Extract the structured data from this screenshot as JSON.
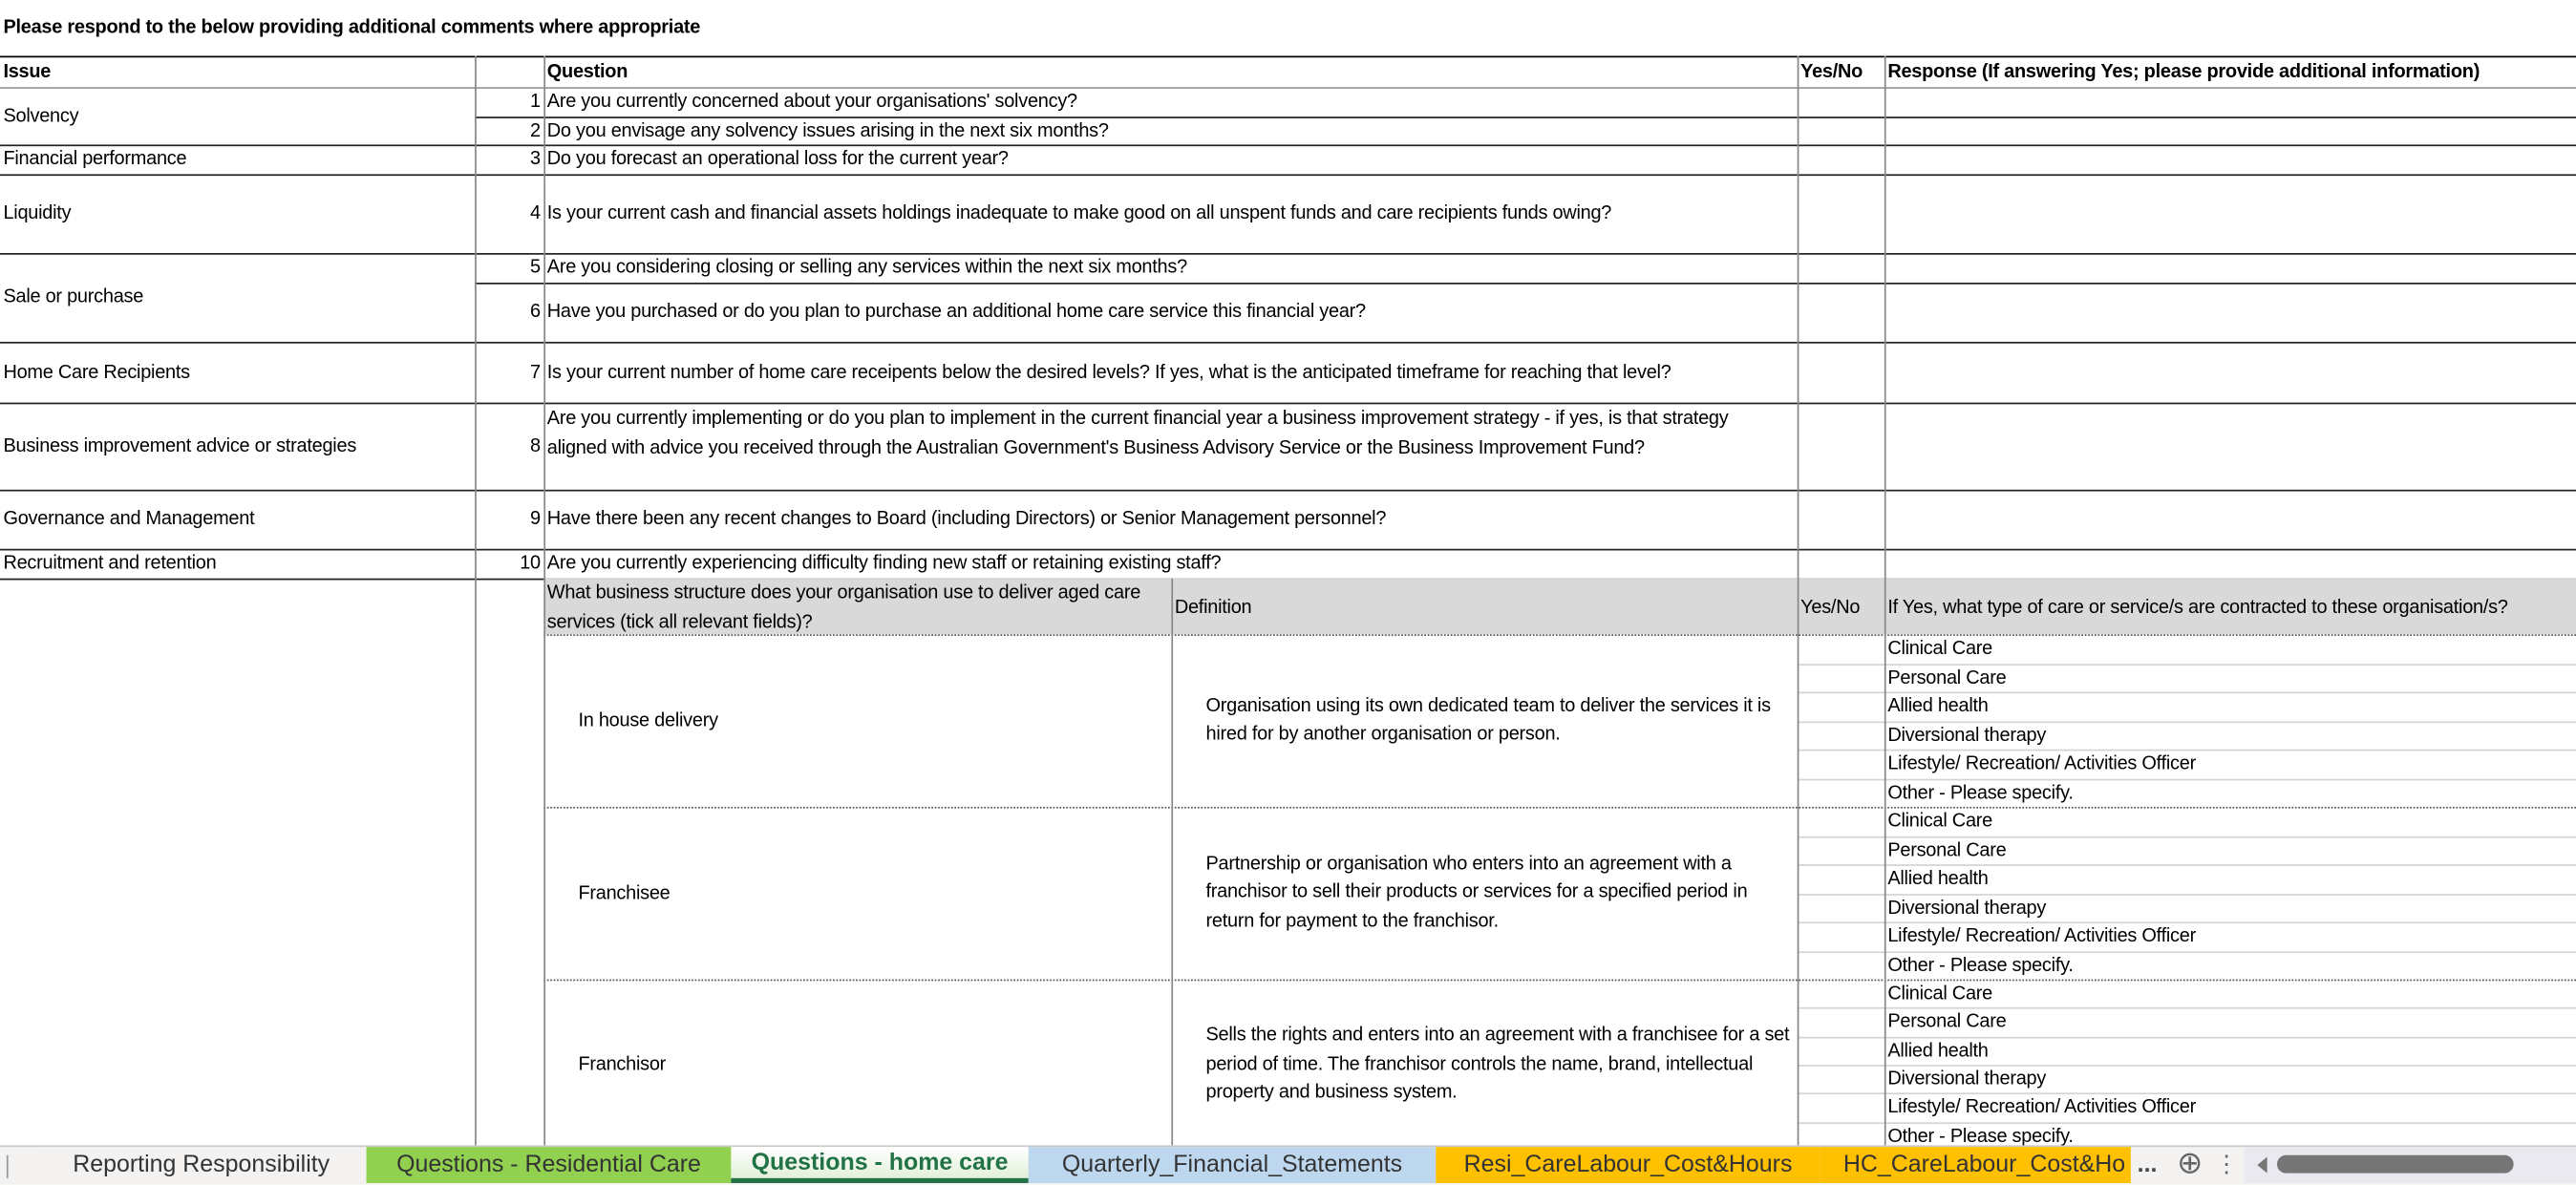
{
  "title": "Please respond to the below providing additional comments where appropriate",
  "header": {
    "issue": "Issue",
    "question": "Question",
    "yes_no": "Yes/No",
    "response": "Response (If answering Yes; please provide additional information)"
  },
  "issues": [
    {
      "label": "Solvency"
    },
    {
      "label": "Financial performance"
    },
    {
      "label": "Liquidity"
    },
    {
      "label": "Sale or purchase"
    },
    {
      "label": "Home Care Recipients"
    },
    {
      "label": "Business improvement advice or strategies"
    },
    {
      "label": "Governance and Management"
    },
    {
      "label": "Recruitment and retention"
    }
  ],
  "questions": [
    {
      "num": "1",
      "text": "Are you currently concerned about your organisations' solvency?"
    },
    {
      "num": "2",
      "text": "Do you envisage any solvency issues arising in the next six months?"
    },
    {
      "num": "3",
      "text": "Do you forecast an operational loss for the current year?"
    },
    {
      "num": "4",
      "text": "Is your current cash and financial assets holdings inadequate to make good on all unspent funds and care recipients funds owing?"
    },
    {
      "num": "5",
      "text": "Are you considering closing or selling any services within the next six months?"
    },
    {
      "num": "6",
      "text": "Have you purchased or do you plan to purchase an additional home care service this financial year?"
    },
    {
      "num": "7",
      "text": "Is your current number of home care receipents below the desired levels? If yes, what is the anticipated timeframe for reaching that level?"
    },
    {
      "num": "8",
      "text": "Are you currently implementing or do you plan to implement in the current financial year a business improvement strategy - if yes, is that strategy aligned with advice you received through the Australian Government's Business Advisory Service or the Business Improvement Fund?"
    },
    {
      "num": "9",
      "text": "Have there been any recent changes to Board (including Directors) or Senior Management personnel?"
    },
    {
      "num": "10",
      "text": "Are you currently experiencing difficulty finding new staff or retaining existing staff?"
    }
  ],
  "structure": {
    "header": {
      "question": "What business structure does your organisation use to deliver aged care services (tick all relevant fields)?",
      "definition": "Definition",
      "yes_no": "Yes/No",
      "response": "If Yes, what type of care or service/s are contracted to these organisation/s?"
    },
    "blocks": [
      {
        "name": "In house delivery",
        "definition": "Organisation using its own dedicated team to deliver the services it is hired for by another organisation or person.",
        "options": [
          "Clinical Care",
          "Personal Care",
          "Allied health",
          "Diversional therapy",
          "Lifestyle/ Recreation/ Activities Officer",
          "Other - Please specify."
        ]
      },
      {
        "name": "Franchisee",
        "definition": "Partnership or organisation who enters into an agreement with a franchisor to sell their products or services for a specified period in return for payment to the franchisor.",
        "options": [
          "Clinical Care",
          "Personal Care",
          "Allied health",
          "Diversional therapy",
          "Lifestyle/ Recreation/ Activities Officer",
          "Other - Please specify."
        ]
      },
      {
        "name": "Franchisor",
        "definition": "Sells the rights and enters into an agreement with a franchisee for a set period of time. The franchisor controls the name, brand, intellectual property and business system.",
        "options": [
          "Clinical Care",
          "Personal Care",
          "Allied health",
          "Diversional therapy",
          "Lifestyle/ Recreation/ Activities Officer",
          "Other - Please specify."
        ]
      }
    ]
  },
  "sheet_tabs": [
    {
      "label": "Reporting Responsibility",
      "color": "#f3f2f1",
      "active": false
    },
    {
      "label": "Questions - Residential Care",
      "color": "#92d050",
      "active": false
    },
    {
      "label": "Questions - home care",
      "color": "#ffffff",
      "active": true
    },
    {
      "label": "Quarterly_Financial_Statements",
      "color": "#bdd7ee",
      "active": false
    },
    {
      "label": "Resi_CareLabour_Cost&Hours",
      "color": "#ffc000",
      "active": false
    },
    {
      "label": "HC_CareLabour_Cost&Ho",
      "color": "#ffc000",
      "active": false
    }
  ],
  "tab_controls": {
    "more": "...",
    "add": "⊕",
    "options": "⋮"
  },
  "colors": {
    "header_fill": "#d9d9d9",
    "active_tab_text": "#217346"
  }
}
